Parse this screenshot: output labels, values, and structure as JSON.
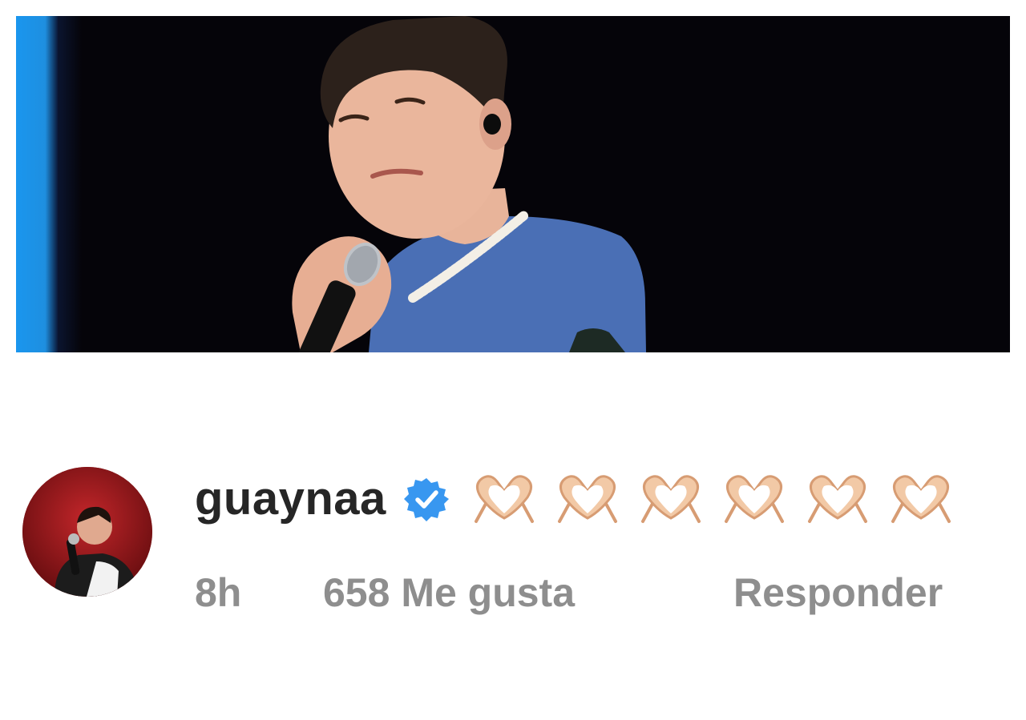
{
  "photo": {
    "subject": "singer-with-microphone",
    "colors": {
      "background": "#050409",
      "stage_light": "#1a96ee",
      "shirt": "#4a6fb5"
    }
  },
  "comment": {
    "avatar_icon": "user-avatar-icon",
    "username": "guaynaa",
    "verified_icon": "verified-badge-icon",
    "verified_color": "#3897f0",
    "emoji_icon": "heart-hands-emoji",
    "emoji_count": 6,
    "time": "8h",
    "likes": "658 Me gusta",
    "reply": "Responder"
  }
}
